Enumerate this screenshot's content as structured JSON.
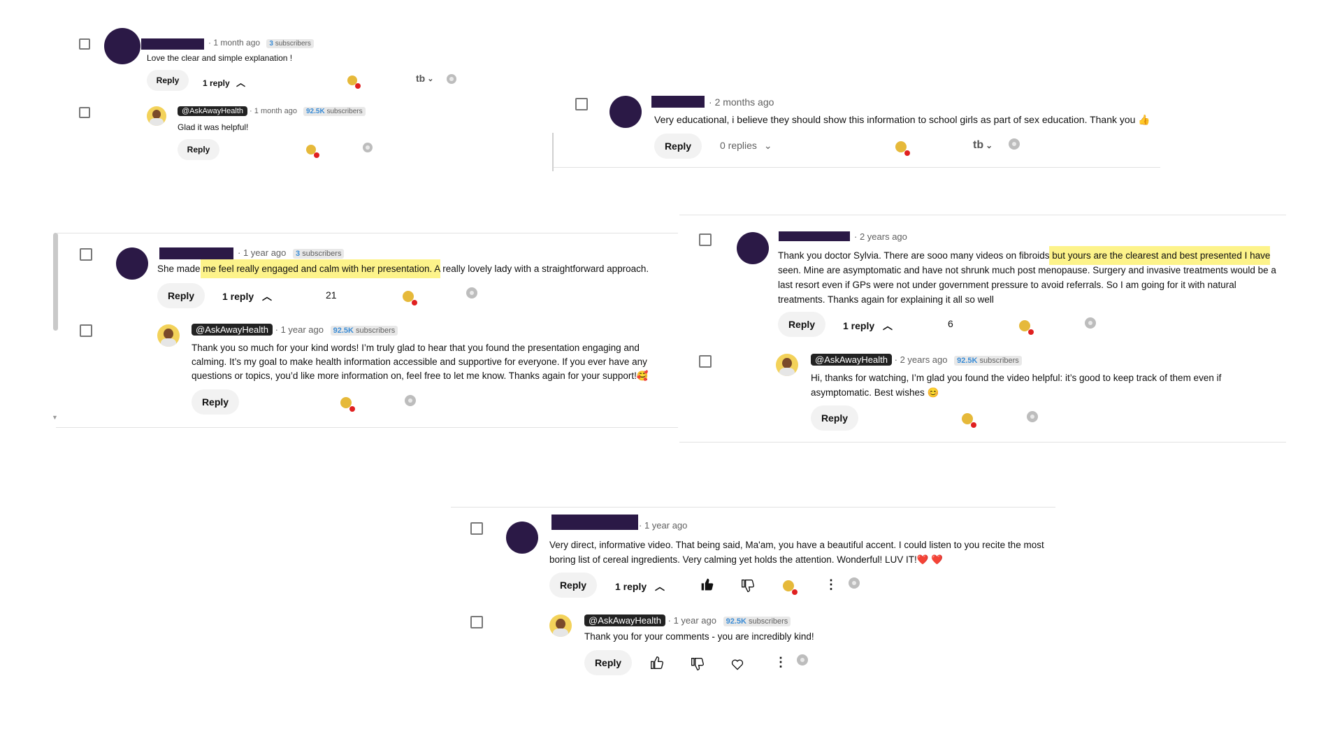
{
  "c1": {
    "time": "1 month ago",
    "subs_num": "3",
    "subs_label": "subscribers",
    "text": "Love the clear and simple explanation !",
    "reply": "Reply",
    "replies": "1 reply",
    "sort_glyph": "tb",
    "r": {
      "handle": "@AskAwayHealth",
      "time": "1 month ago",
      "subs_num": "92.5K",
      "subs_label": "subscribers",
      "text": "Glad it was helpful!",
      "reply": "Reply"
    }
  },
  "c2": {
    "time": "2 months ago",
    "text": "Very educational, i believe they should show this information to school girls as part of sex education. Thank you",
    "emoji": "👍",
    "reply": "Reply",
    "replies": "0 replies",
    "sort_glyph": "tb"
  },
  "c3": {
    "time": "1 year ago",
    "subs_num": "3",
    "subs_label": "subscribers",
    "text_pre": "She made",
    "text_hl": " me feel really engaged and calm with her presentation. A",
    "text_post": " really lovely lady with a straightforward approach.",
    "reply": "Reply",
    "replies": "1 reply",
    "likes": "21",
    "r": {
      "handle": "@AskAwayHealth",
      "time": "1 year ago",
      "subs_num": "92.5K",
      "subs_label": "subscribers",
      "text": "Thank you so much for your kind words! I’m truly glad to hear that you found the presentation engaging and calming. It’s my goal to make health information accessible and supportive for everyone. If you ever have any questions or topics, you’d like more information on, feel free to let me know. Thanks again for your support!",
      "emoji": "🥰",
      "reply": "Reply"
    }
  },
  "c4": {
    "time": "2 years ago",
    "text_pre": "Thank you doctor Sylvia. There are sooo many videos on fibroids",
    "text_hl": " but yours are the clearest and best presented I have",
    "text_post": " seen. Mine are asymptomatic and have not shrunk much post menopause. Surgery and invasive treatments would be a last resort even if GPs were not under government pressure to avoid referrals. So I am going for it with natural treatments. Thanks again for explaining it all so well",
    "reply": "Reply",
    "replies": "1 reply",
    "likes": "6",
    "r": {
      "handle": "@AskAwayHealth",
      "time": "2 years ago",
      "subs_num": "92.5K",
      "subs_label": "subscribers",
      "text": "Hi, thanks for watching, I’m glad you found the video helpful: it’s good to keep track of them even if asymptomatic. Best wishes",
      "emoji": "😊",
      "reply": "Reply"
    }
  },
  "c5": {
    "time": "1 year ago",
    "text": "Very direct, informative video. That being said, Ma'am, you have a beautiful accent. I could listen to you recite the most boring list of cereal ingredients. Very calming yet holds the attention. Wonderful!  LUV IT!",
    "emoji": "❤️ ❤️",
    "reply": "Reply",
    "replies": "1 reply",
    "r": {
      "handle": "@AskAwayHealth",
      "time": "1 year ago",
      "subs_num": "92.5K",
      "subs_label": "subscribers",
      "text": "Thank you for your comments - you are incredibly kind!",
      "reply": "Reply"
    }
  },
  "colors": {
    "redaction": "#2b1946",
    "highlight": "#fdf38a",
    "link_blue": "#3a8cd6"
  }
}
